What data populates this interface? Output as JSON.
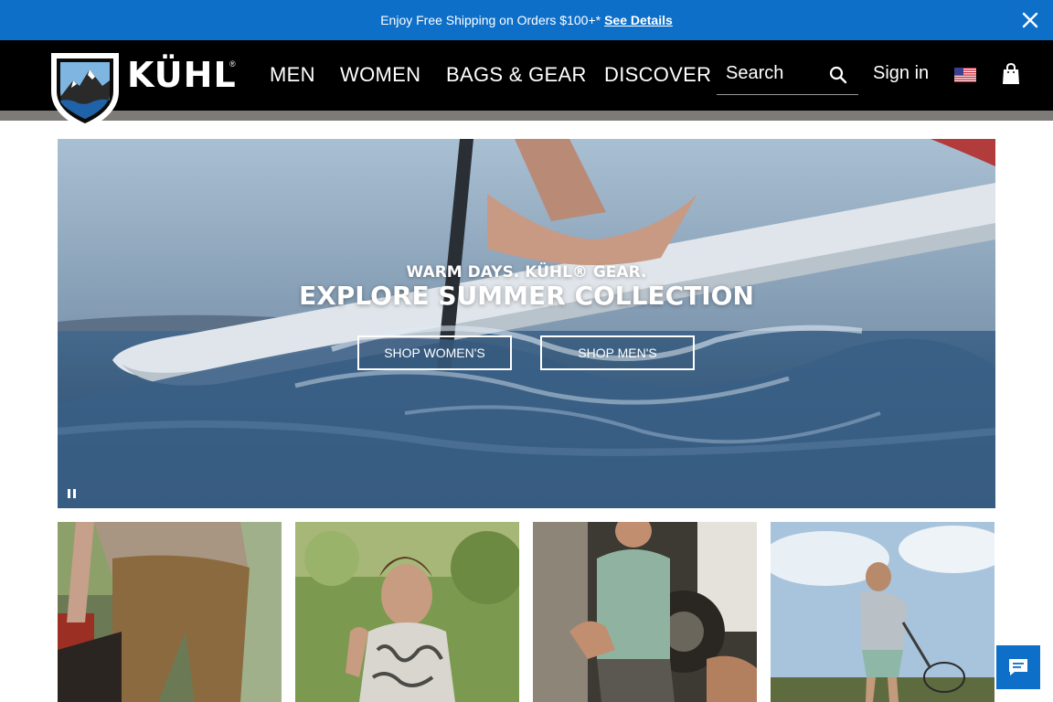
{
  "promo": {
    "text": "Enjoy Free Shipping on Orders $100+*",
    "link": "See Details"
  },
  "brand": {
    "name": "KÜHL",
    "reg_mark": "®"
  },
  "nav": {
    "items": [
      {
        "label": "MEN"
      },
      {
        "label": "WOMEN"
      },
      {
        "label": "BAGS & GEAR"
      },
      {
        "label": "DISCOVER"
      }
    ]
  },
  "search": {
    "label": "Search"
  },
  "account": {
    "sign_in": "Sign in"
  },
  "hero": {
    "kicker": "WARM DAYS. KÜHL® GEAR.",
    "headline": "EXPLORE SUMMER COLLECTION",
    "buttons": [
      {
        "label": "SHOP WOMEN'S"
      },
      {
        "label": "SHOP MEN'S"
      }
    ]
  },
  "icons": {
    "close": "close-icon",
    "search": "search-icon",
    "flag": "us-flag-icon",
    "bag": "shopping-bag-icon",
    "pause": "pause-icon",
    "chat": "chat-icon"
  },
  "colors": {
    "promo_bg": "#0e6fc9",
    "header_bg": "#000000",
    "subbar": "#7d7b78",
    "chat_bg": "#0e6fc9"
  }
}
